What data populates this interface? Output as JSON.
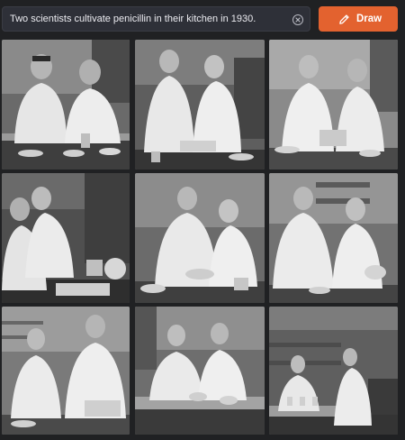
{
  "prompt": {
    "value": "Two scientists cultivate penicillin in their kitchen in 1930."
  },
  "draw_button": {
    "label": "Draw"
  },
  "icons": {
    "clear": "clear-circle-x-icon",
    "draw": "pencil-icon"
  },
  "colors": {
    "background": "#202123",
    "input_bg": "#2e3038",
    "accent": "#e3622f",
    "text": "#ececf1"
  },
  "results": {
    "count": 9,
    "style": "black-and-white photograph"
  }
}
